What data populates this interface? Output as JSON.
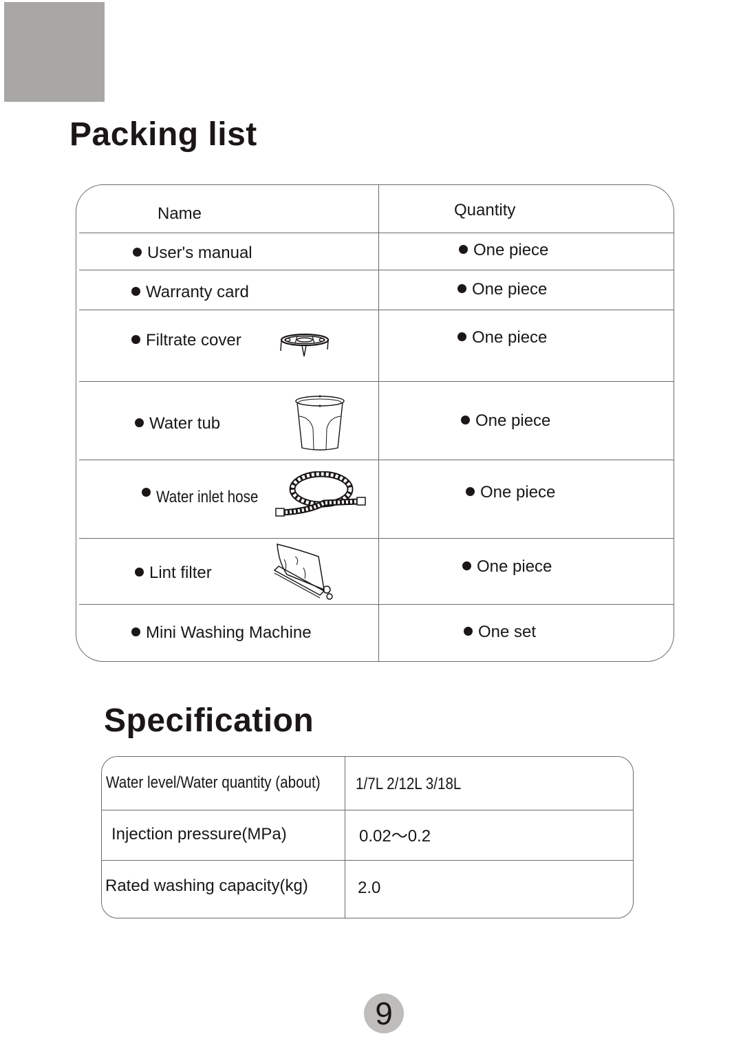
{
  "packing_list": {
    "title": "Packing list",
    "headers": {
      "name": "Name",
      "quantity": "Quantity"
    },
    "rows": [
      {
        "name": "User's manual",
        "quantity": "One piece",
        "icon": "none"
      },
      {
        "name": "Warranty card",
        "quantity": "One piece",
        "icon": "none"
      },
      {
        "name": "Filtrate cover",
        "quantity": "One piece",
        "icon": "filtrate-cover-icon"
      },
      {
        "name": "Water tub",
        "quantity": "One piece",
        "icon": "water-tub-icon"
      },
      {
        "name": "Water inlet hose",
        "quantity": "One piece",
        "icon": "water-inlet-hose-icon"
      },
      {
        "name": "Lint filter",
        "quantity": "One piece",
        "icon": "lint-filter-icon"
      },
      {
        "name": "Mini Washing Machine",
        "quantity": "One set",
        "icon": "none"
      }
    ]
  },
  "specification": {
    "title": "Specification",
    "rows": [
      {
        "label": "Water level/Water quantity (about)",
        "value": "1/7L  2/12L 3/18L"
      },
      {
        "label": "Injection pressure(MPa)",
        "value": "0.02～0.2"
      },
      {
        "label": "Rated washing capacity(kg)",
        "value": "2.0"
      }
    ]
  },
  "page": {
    "number": "9"
  },
  "colors": {
    "corner_block": "#a8a7a5",
    "page_badge": "#bebdbc",
    "text": "#1a1716",
    "rule": "#6b6b6b"
  }
}
